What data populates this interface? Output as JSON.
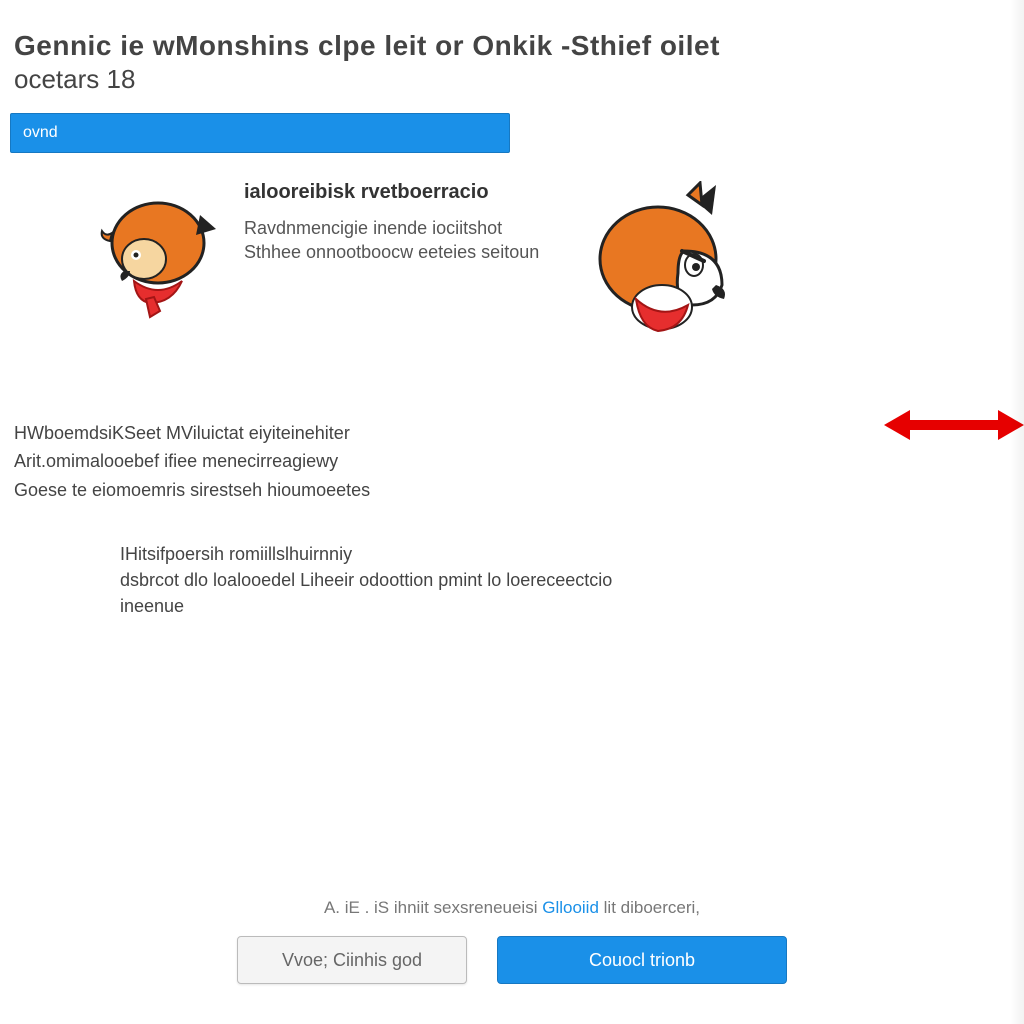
{
  "title": {
    "line1": "Gennic  ie  wMonshins   clpe  leit   or   Onkik  -Sthief    oilet",
    "line2": "ocetars  18"
  },
  "banner": {
    "label": "ovnd"
  },
  "intro": {
    "heading": "ialooreibisk rvetboerracio",
    "body": "Ravdnmencigie inende iociitshot Sthhee onnootboocw eeteies seitoun"
  },
  "paragraph": {
    "p1": "HWboemdsiKSeet  MViluictat  eiyiteinehiter",
    "p2": "Arit.omimalooebef  ifiee  menecirreagiewy",
    "p3": "Goese te eiomoemris sirestseh  hioumoeetes"
  },
  "subparagraph": {
    "p1": "IHitsifpoersih romiillslhuirnniy",
    "p2": "dsbrcot dlo  loalooedel  Liheeir  odoottion pmint  lo loereceectcio",
    "p3": "ineenue"
  },
  "footer": {
    "caption_prefix": "A. iE  .   iS ihniit sexsreneueisi   ",
    "caption_link": "Gllooiid",
    "caption_suffix": "   lit diboerceri,",
    "secondary_label": "Vvoe; Ciinhis god",
    "primary_label": "Couocl trionb"
  }
}
